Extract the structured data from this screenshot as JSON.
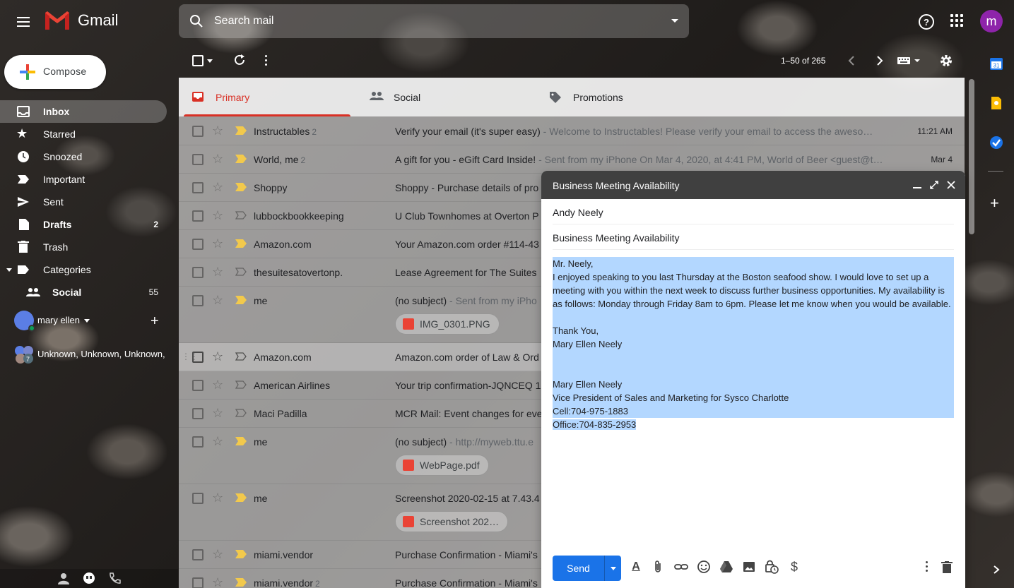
{
  "app": {
    "name": "Gmail",
    "avatar_letter": "m",
    "accent": "#d93025"
  },
  "search": {
    "placeholder": "Search mail"
  },
  "compose_label": "Compose",
  "nav": {
    "items": [
      {
        "label": "Inbox",
        "icon": "inbox-icon",
        "count": ""
      },
      {
        "label": "Starred",
        "icon": "star-icon",
        "count": ""
      },
      {
        "label": "Snoozed",
        "icon": "clock-icon",
        "count": ""
      },
      {
        "label": "Important",
        "icon": "label-important-icon",
        "count": ""
      },
      {
        "label": "Sent",
        "icon": "send-icon",
        "count": ""
      },
      {
        "label": "Drafts",
        "icon": "draft-icon",
        "count": "2"
      },
      {
        "label": "Trash",
        "icon": "trash-icon",
        "count": ""
      },
      {
        "label": "Categories",
        "icon": "label-icon",
        "count": ""
      },
      {
        "label": "Social",
        "icon": "people-icon",
        "count": "55"
      }
    ]
  },
  "hangouts": {
    "user": "mary ellen",
    "group": "Unknown, Unknown, Unknown,",
    "group_count": "7"
  },
  "toolbar": {
    "range": "1–50 of 265"
  },
  "tabs": [
    {
      "label": "Primary"
    },
    {
      "label": "Social"
    },
    {
      "label": "Promotions"
    }
  ],
  "emails": [
    {
      "sender": "Instructables",
      "count": "2",
      "subject": "Verify your email (it's super easy)",
      "snippet": " - Welcome to Instructables! Please verify your email to access the aweso…",
      "date": "11:21 AM",
      "important": true
    },
    {
      "sender": "World, me",
      "count": "2",
      "subject": "A gift for you - eGift Card Inside!",
      "snippet": " - Sent from my iPhone On Mar 4, 2020, at 4:41 PM, World of Beer <guest@t…",
      "date": "Mar 4",
      "important": true
    },
    {
      "sender": "Shoppy",
      "count": "",
      "subject": "Shoppy - Purchase details of pro",
      "snippet": "",
      "date": "",
      "important": true
    },
    {
      "sender": "lubbockbookkeeping",
      "count": "",
      "subject": "U Club Townhomes at Overton P",
      "snippet": "",
      "date": "",
      "important": false
    },
    {
      "sender": "Amazon.com",
      "count": "",
      "subject": "Your Amazon.com order #114-43",
      "snippet": "",
      "date": "",
      "important": true
    },
    {
      "sender": "thesuitesatovertonp.",
      "count": "",
      "subject": "Lease Agreement for The Suites",
      "snippet": "",
      "date": "",
      "important": false
    },
    {
      "sender": "me",
      "count": "",
      "subject": "(no subject)",
      "snippet": " - Sent from my iPho",
      "date": "",
      "important": true,
      "attachment": "IMG_0301.PNG"
    },
    {
      "sender": "Amazon.com",
      "count": "",
      "subject": "Amazon.com order of Law & Ord",
      "snippet": "",
      "date": "",
      "important": false
    },
    {
      "sender": "American Airlines",
      "count": "",
      "subject": "Your trip confirmation-JQNCEQ 1",
      "snippet": "",
      "date": "",
      "important": false
    },
    {
      "sender": "Maci Padilla",
      "count": "",
      "subject": "MCR Mail: Event changes for eve",
      "snippet": "",
      "date": "",
      "important": false
    },
    {
      "sender": "me",
      "count": "",
      "subject": "(no subject)",
      "snippet": " - http://myweb.ttu.e",
      "date": "",
      "important": true,
      "attachment": "WebPage.pdf"
    },
    {
      "sender": "me",
      "count": "",
      "subject": "Screenshot 2020-02-15 at 7.43.4",
      "snippet": "",
      "date": "",
      "important": true,
      "attachment": "Screenshot 202…"
    },
    {
      "sender": "miami.vendor",
      "count": "",
      "subject": "Purchase Confirmation - Miami's",
      "snippet": "",
      "date": "",
      "important": true
    },
    {
      "sender": "miami.vendor",
      "count": "2",
      "subject": "Purchase Confirmation - Miami's",
      "snippet": "",
      "date": "",
      "important": true
    }
  ],
  "compose_window": {
    "title": "Business Meeting Availability",
    "to": "Andy Neely",
    "subject": "Business Meeting Availability",
    "body": [
      "Mr. Neely,",
      "I enjoyed speaking to you last Thursday at the Boston seafood show. I would love to set up a meeting with you within the next week to discuss further business opportunities. My availability is as follows: Monday through Friday 8am to 6pm. Please let me know when you would be available.",
      "",
      "Thank You,",
      "Mary Ellen Neely",
      "",
      "",
      "Mary Ellen Neely",
      "Vice President of Sales and Marketing for Sysco Charlotte",
      "Cell:704-975-1883",
      "Office:704-835-2953"
    ],
    "send_label": "Send"
  }
}
